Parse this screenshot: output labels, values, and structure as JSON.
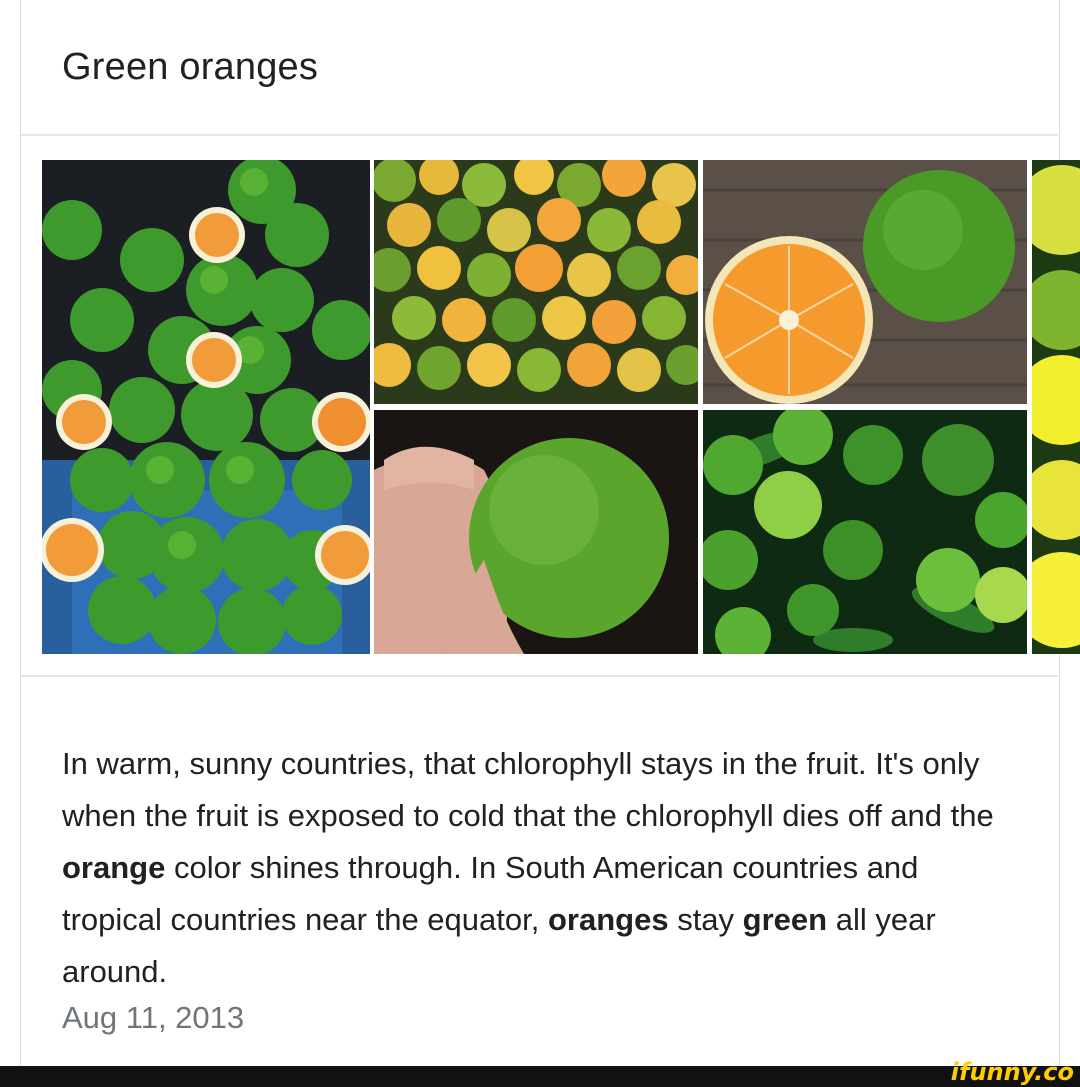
{
  "card": {
    "title": "Green oranges"
  },
  "gallery": {
    "images": [
      {
        "alt": "stacked green oranges in blue buckets"
      },
      {
        "alt": "pile of green and yellow oranges"
      },
      {
        "alt": "cut orange on wooden table"
      },
      {
        "alt": "hand holding green orange"
      },
      {
        "alt": "green oranges with leaves"
      },
      {
        "alt": "yellow citrus"
      }
    ]
  },
  "snippet": {
    "t1": "In warm, sunny countries, that chlorophyll stays in the fruit. It's only when the fruit is exposed to cold that the chlorophyll dies off and the ",
    "b1": "orange",
    "t2": " color shines through. In South American countries and tropical countries near the equator, ",
    "b2": "oranges",
    "t3": " stay ",
    "b3": "green",
    "t4": " all year around."
  },
  "date": "Aug 11, 2013",
  "watermark": "ifunny.co",
  "colors": {
    "text": "#202124",
    "muted": "#70757a",
    "divider": "#e6e6e6",
    "watermark": "#ffcc00"
  }
}
